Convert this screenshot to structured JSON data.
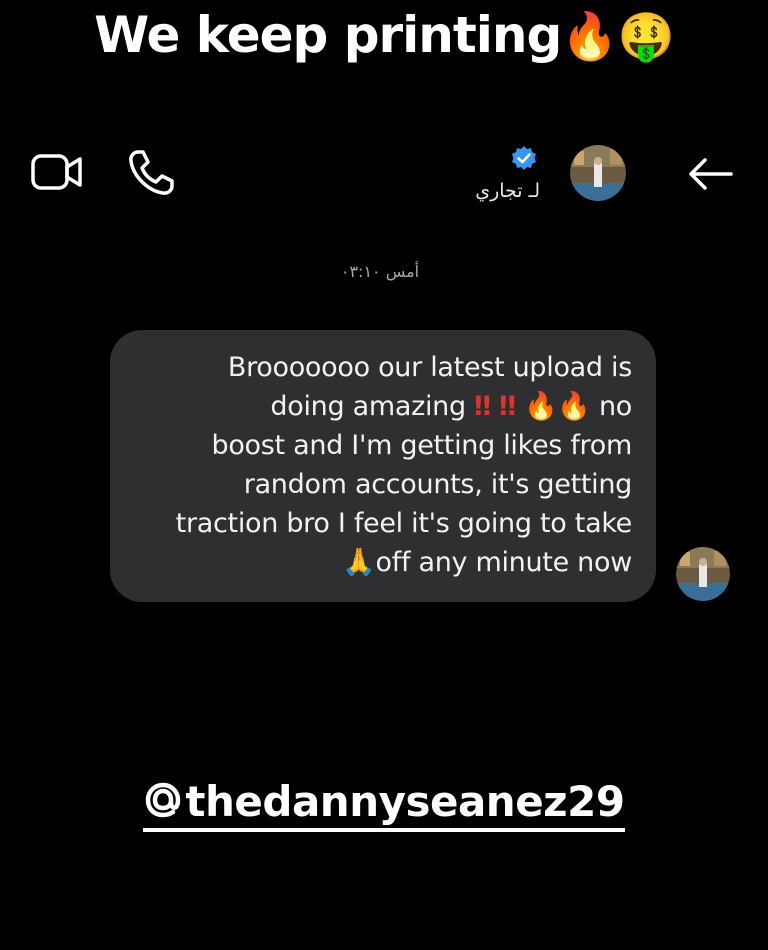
{
  "story": {
    "caption_text": "We keep printing",
    "caption_emojis": "🔥🤑",
    "mention": "thedannyseanez29"
  },
  "header": {
    "contact_name": "لـ تجاري",
    "verified": true,
    "icons": [
      "video-call-icon",
      "phone-call-icon",
      "back-arrow-icon",
      "verified-badge-icon"
    ]
  },
  "chat": {
    "timestamp": "أمس ٠٣:١٠",
    "message_lines": [
      "Brooooooo our latest upload is",
      "doing amazing",
      "no",
      "boost and I'm getting likes from",
      "random accounts, it's getting",
      "traction bro I feel it's going to take",
      "off any minute now"
    ],
    "emojis": {
      "double_exclamation": "‼",
      "fire": "🔥",
      "pray": "🙏"
    }
  },
  "colors": {
    "background": "#000000",
    "bubble": "#2f2f31",
    "text": "#f2f2f2",
    "timestamp": "#a8a8a8",
    "verified": "#3797f0",
    "exclamation": "#e0332f"
  }
}
